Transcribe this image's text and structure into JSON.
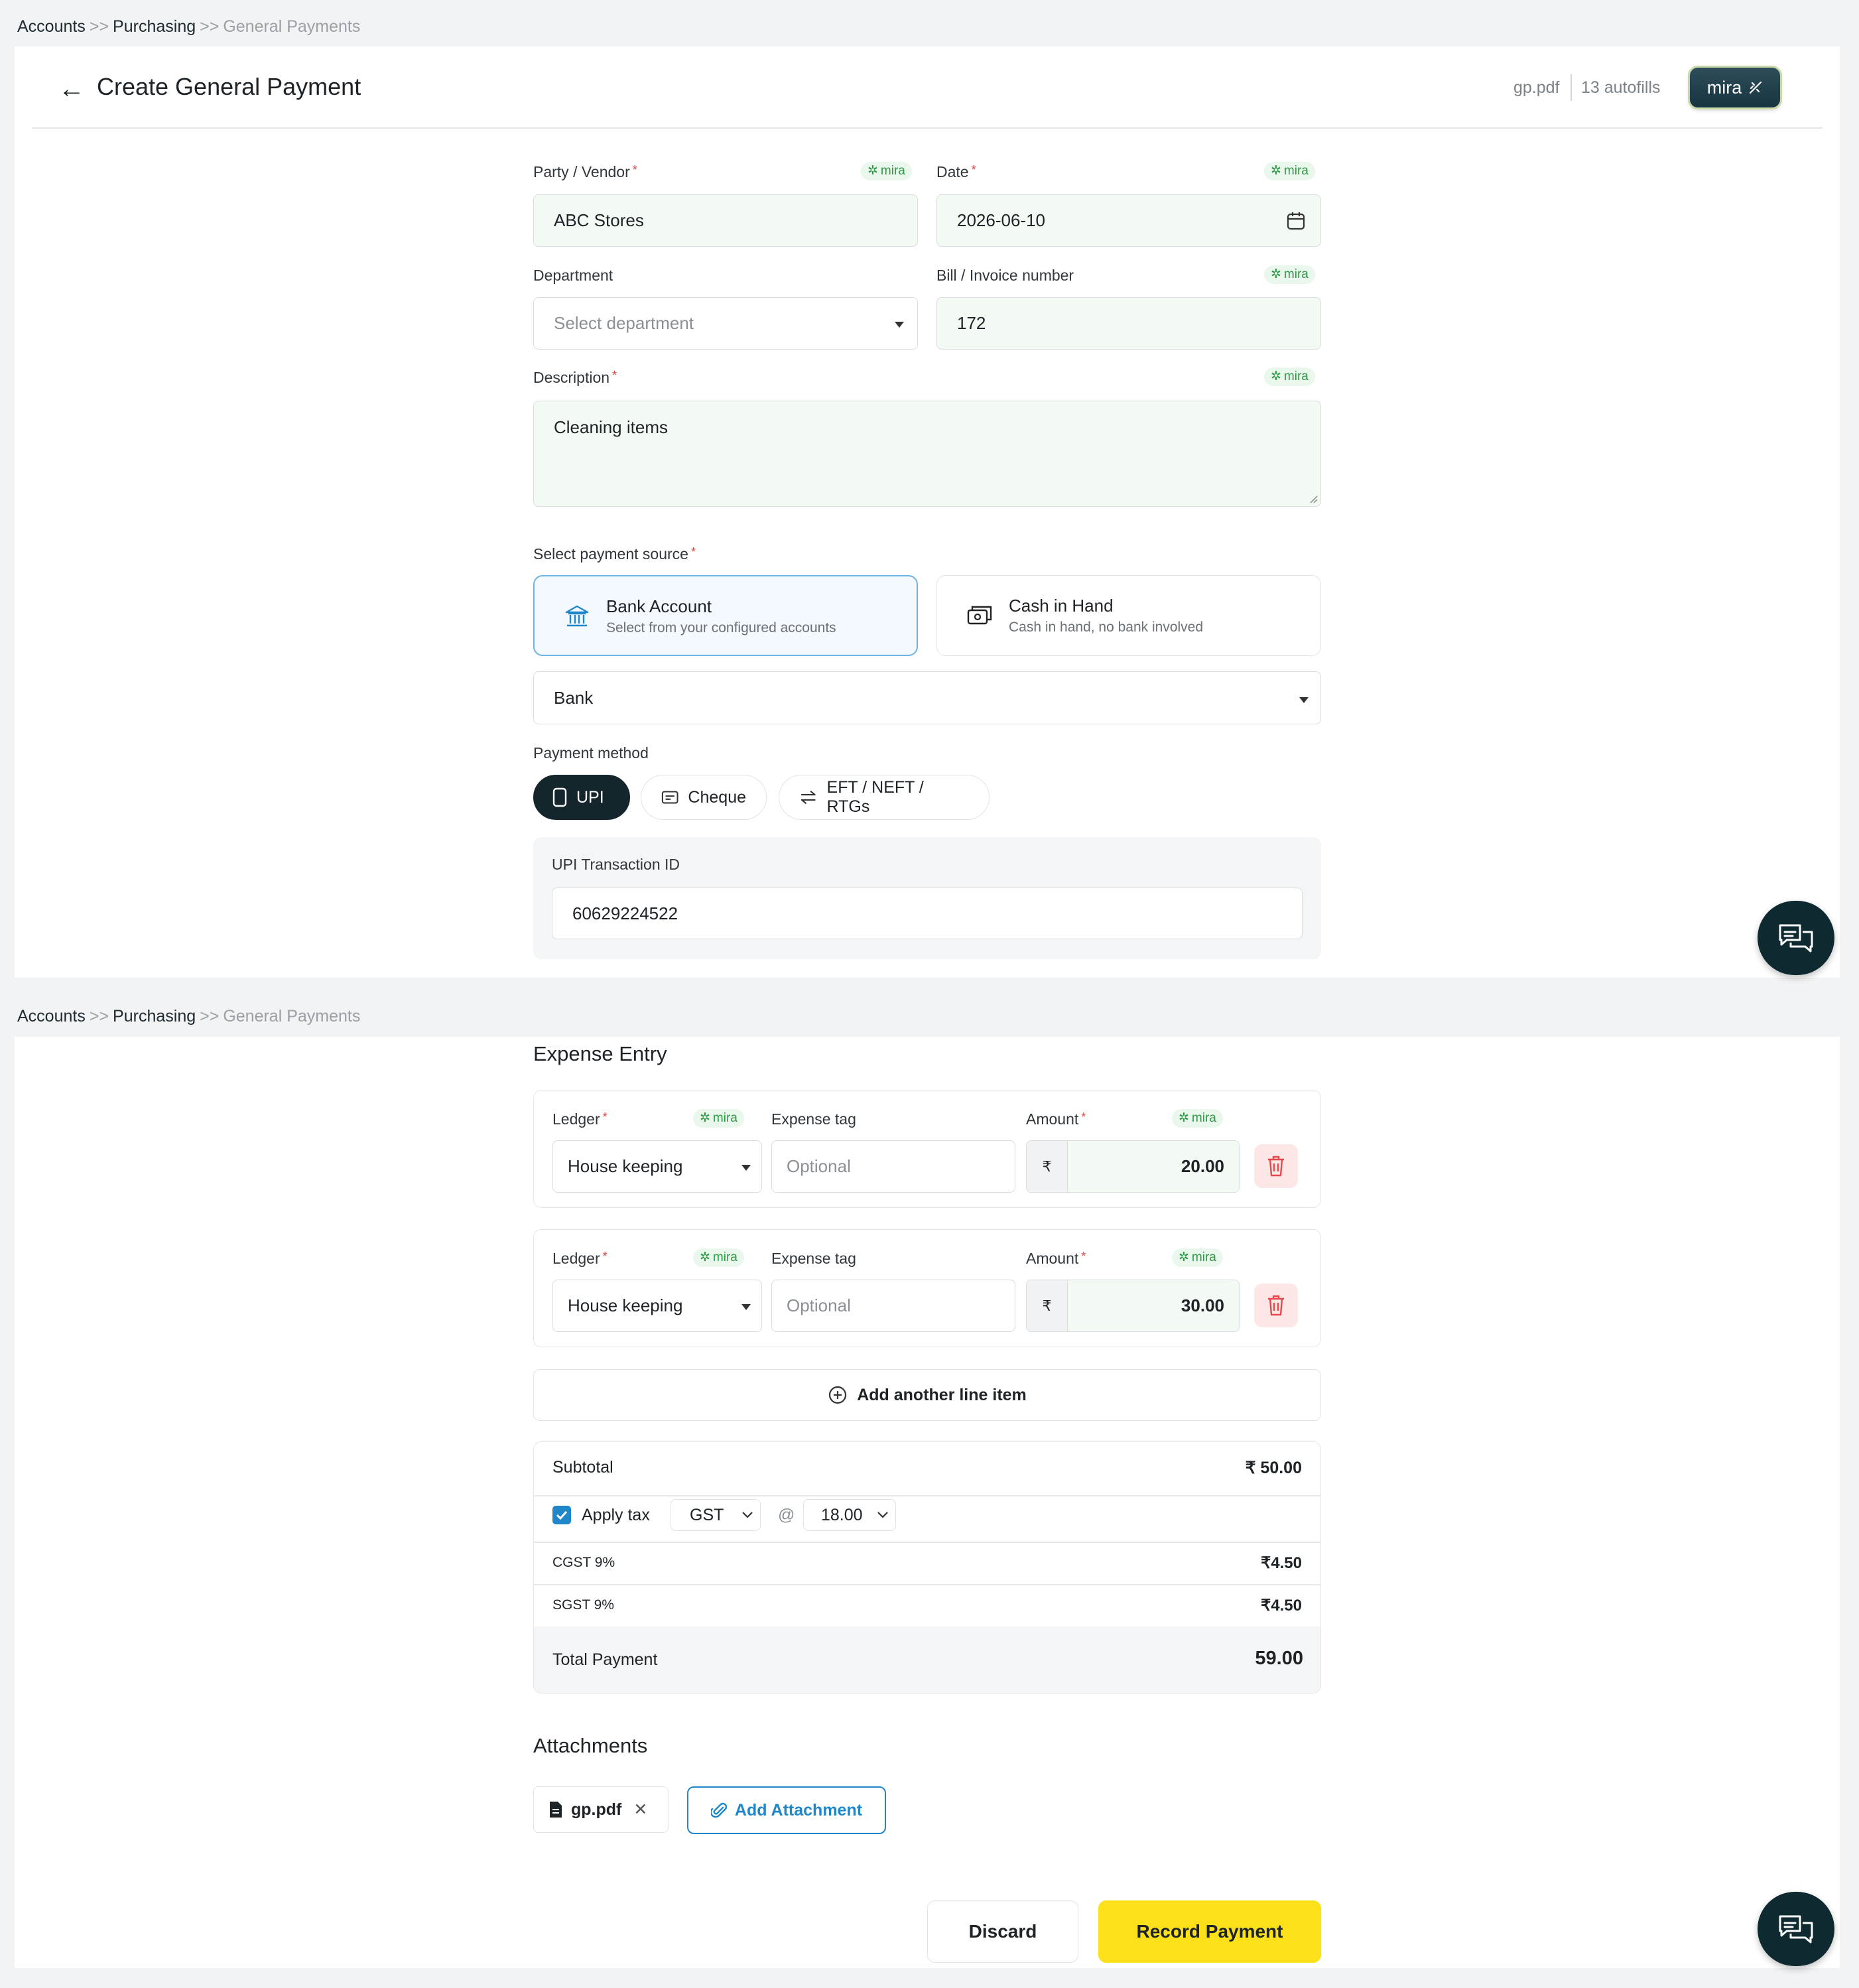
{
  "breadcrumb": {
    "items": [
      "Accounts",
      "Purchasing",
      "General Payments"
    ],
    "separator": ">>"
  },
  "header": {
    "title": "Create General Payment",
    "file": "gp.pdf",
    "autofills": "13 autofills",
    "mira_button": "mira"
  },
  "mira_chip": "mira",
  "form": {
    "party_label": "Party / Vendor",
    "party_value": "ABC Stores",
    "date_label": "Date",
    "date_value": "2026-06-10",
    "department_label": "Department",
    "department_placeholder": "Select department",
    "bill_label": "Bill / Invoice number",
    "bill_value": "172",
    "description_label": "Description",
    "description_value": "Cleaning items",
    "source_label": "Select payment source",
    "sources": [
      {
        "title": "Bank Account",
        "subtitle": "Select from your configured accounts",
        "selected": true
      },
      {
        "title": "Cash in Hand",
        "subtitle": "Cash in hand, no bank involved",
        "selected": false
      }
    ],
    "bank_select": "Bank",
    "method_label": "Payment method",
    "methods": [
      "UPI",
      "Cheque",
      "EFT / NEFT / RTGs"
    ],
    "upi_label": "UPI Transaction ID",
    "upi_value": "60629224522"
  },
  "expense": {
    "title": "Expense Entry",
    "ledger_label": "Ledger",
    "tag_label": "Expense tag",
    "amount_label": "Amount",
    "currency": "₹",
    "tag_placeholder": "Optional",
    "rows": [
      {
        "ledger": "House keeping",
        "amount": "20.00"
      },
      {
        "ledger": "House keeping",
        "amount": "30.00"
      }
    ],
    "add_line": "Add another line item"
  },
  "summary": {
    "subtotal_label": "Subtotal",
    "subtotal_value": "₹ 50.00",
    "apply_tax_label": "Apply tax",
    "tax_type": "GST",
    "at": "@",
    "tax_rate": "18.00",
    "cgst_label": "CGST 9%",
    "cgst_value": "₹4.50",
    "sgst_label": "SGST 9%",
    "sgst_value": "₹4.50",
    "total_label": "Total Payment",
    "total_value": "59.00"
  },
  "attachments": {
    "title": "Attachments",
    "file": "gp.pdf",
    "add_label": "Add Attachment"
  },
  "actions": {
    "discard": "Discard",
    "record": "Record Payment"
  },
  "colors": {
    "accent_blue": "#1f87c9",
    "dark": "#0e2a30",
    "record_yellow": "#fce01a",
    "mira_green": "#2f9a45"
  }
}
